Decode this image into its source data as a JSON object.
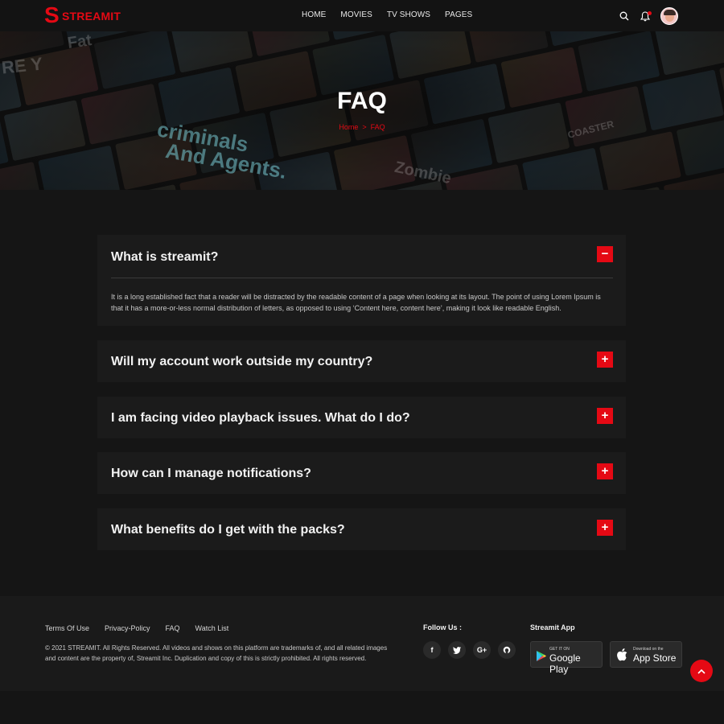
{
  "brand": {
    "name": "STREAMIT",
    "logo_letter": "S"
  },
  "nav": [
    {
      "label": "HOME"
    },
    {
      "label": "MOVIES"
    },
    {
      "label": "TV SHOWS"
    },
    {
      "label": "PAGES"
    }
  ],
  "header_icons": {
    "search": "search-icon",
    "notifications": "bell-icon",
    "avatar": "user-avatar"
  },
  "hero": {
    "title": "FAQ",
    "breadcrumb": {
      "home": "Home",
      "separator": ">",
      "current": "FAQ"
    },
    "poster_words": [
      "Fat",
      "criminals",
      "And Agents.",
      "Zombie",
      "COASTER",
      "RE Y"
    ]
  },
  "faq": [
    {
      "question": "What is streamit?",
      "expanded": true,
      "toggle": "−",
      "answer": "It is a long established fact that a reader will be distracted by the readable content of a page when looking at its layout. The point of using Lorem Ipsum is that it has a more-or-less normal distribution of letters, as opposed to using ‘Content here, content here’, making it look like readable English."
    },
    {
      "question": "Will my account work outside my country?",
      "expanded": false,
      "toggle": "+"
    },
    {
      "question": "I am facing video playback issues. What do I do?",
      "expanded": false,
      "toggle": "+"
    },
    {
      "question": "How can I manage notifications?",
      "expanded": false,
      "toggle": "+"
    },
    {
      "question": "What benefits do I get with the packs?",
      "expanded": false,
      "toggle": "+"
    }
  ],
  "footer": {
    "links": [
      {
        "label": "Terms Of Use"
      },
      {
        "label": "Privacy-Policy"
      },
      {
        "label": "FAQ"
      },
      {
        "label": "Watch List"
      }
    ],
    "copyright": "© 2021 STREAMIT. All Rights Reserved. All videos and shows on this platform are trademarks of, and all related images and content are the property of, Streamit Inc. Duplication and copy of this is strictly prohibited. All rights reserved.",
    "follow_title": "Follow Us :",
    "socials": [
      {
        "name": "facebook-icon",
        "glyph": "f"
      },
      {
        "name": "twitter-icon",
        "glyph": "✶"
      },
      {
        "name": "google-plus-icon",
        "glyph": "G+"
      },
      {
        "name": "github-icon",
        "glyph": "●"
      }
    ],
    "app_title": "Streamit App",
    "google_play": {
      "small": "GET IT ON",
      "big": "Google Play"
    },
    "app_store": {
      "small": "Download on the",
      "big": "App Store"
    }
  },
  "colors": {
    "accent": "#e50914",
    "background": "#151515",
    "card": "#1b1b1b"
  }
}
